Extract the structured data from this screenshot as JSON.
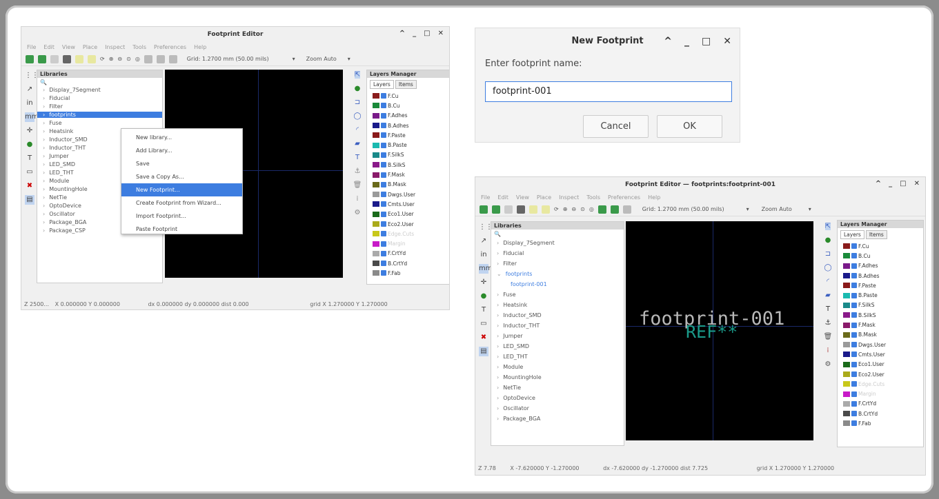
{
  "left_window": {
    "title": "Footprint Editor",
    "menu": [
      "File",
      "Edit",
      "View",
      "Place",
      "Inspect",
      "Tools",
      "Preferences",
      "Help"
    ],
    "grid": "Grid: 1.2700 mm (50.00 mils)",
    "zoom": "Zoom Auto",
    "libraries_header": "Libraries",
    "libraries": [
      "Display_7Segment",
      "Fiducial",
      "Filter",
      "footprints",
      "Fuse",
      "Heatsink",
      "Inductor_SMD",
      "Inductor_THT",
      "Jumper",
      "LED_SMD",
      "LED_THT",
      "Module",
      "MountingHole",
      "NetTie",
      "OptoDevice",
      "Oscillator",
      "Package_BGA",
      "Package_CSP"
    ],
    "layers_header": "Layers Manager",
    "tabs": [
      "Layers",
      "Items"
    ],
    "layers": [
      {
        "name": "F.Cu",
        "color": "#8a1c1c"
      },
      {
        "name": "B.Cu",
        "color": "#1a8a3a"
      },
      {
        "name": "F.Adhes",
        "color": "#7a1a8a"
      },
      {
        "name": "B.Adhes",
        "color": "#1a1a8a"
      },
      {
        "name": "F.Paste",
        "color": "#8a1a1a"
      },
      {
        "name": "B.Paste",
        "color": "#1abab0"
      },
      {
        "name": "F.SilkS",
        "color": "#1a8a8a"
      },
      {
        "name": "B.SilkS",
        "color": "#8a1a8a"
      },
      {
        "name": "F.Mask",
        "color": "#8a1a6a"
      },
      {
        "name": "B.Mask",
        "color": "#6a6a1a"
      },
      {
        "name": "Dwgs.User",
        "color": "#9a9a9a"
      },
      {
        "name": "Cmts.User",
        "color": "#1a1a8a"
      },
      {
        "name": "Eco1.User",
        "color": "#1a6a1a"
      },
      {
        "name": "Eco2.User",
        "color": "#aaaa1a"
      },
      {
        "name": "Edge.Cuts",
        "color": "#c8c81a"
      },
      {
        "name": "Margin",
        "color": "#c81ac8"
      },
      {
        "name": "F.CrtYd",
        "color": "#aaaaaa"
      },
      {
        "name": "B.CrtYd",
        "color": "#4a4a4a"
      },
      {
        "name": "F.Fab",
        "color": "#8a8a8a"
      }
    ],
    "status": {
      "z": "Z 2500...",
      "xy": "X 0.000000  Y 0.000000",
      "dxdy": "dx 0.000000  dy 0.000000  dist 0.000",
      "grid": "grid X 1.270000  Y 1.270000"
    }
  },
  "context_menu": [
    "New library...",
    "Add Library...",
    "Save",
    "Save a Copy As...",
    "New Footprint...",
    "Create Footprint from Wizard...",
    "Import Footprint...",
    "Paste Footprint"
  ],
  "dialog": {
    "title": "New Footprint",
    "prompt": "Enter footprint name:",
    "value": "footprint-001",
    "cancel": "Cancel",
    "ok": "OK"
  },
  "right_window": {
    "title": "Footprint Editor — footprints:footprint-001",
    "menu": [
      "File",
      "Edit",
      "View",
      "Place",
      "Inspect",
      "Tools",
      "Preferences",
      "Help"
    ],
    "grid": "Grid: 1.2700 mm (50.00 mils)",
    "zoom": "Zoom Auto",
    "libraries_header": "Libraries",
    "libraries": [
      "Display_7Segment",
      "Fiducial",
      "Filter",
      "footprints",
      "footprint-001",
      "Fuse",
      "Heatsink",
      "Inductor_SMD",
      "Inductor_THT",
      "Jumper",
      "LED_SMD",
      "LED_THT",
      "Module",
      "MountingHole",
      "NetTie",
      "OptoDevice",
      "Oscillator",
      "Package_BGA"
    ],
    "canvas_value": "footprint-001",
    "canvas_ref": "REF**",
    "layers_header": "Layers Manager",
    "tabs": [
      "Layers",
      "Items"
    ],
    "status": {
      "z": "Z 7.78",
      "xy": "X -7.620000  Y -1.270000",
      "dxdy": "dx -7.620000  dy -1.270000  dist 7.725",
      "grid": "grid X 1.270000  Y 1.270000"
    }
  }
}
